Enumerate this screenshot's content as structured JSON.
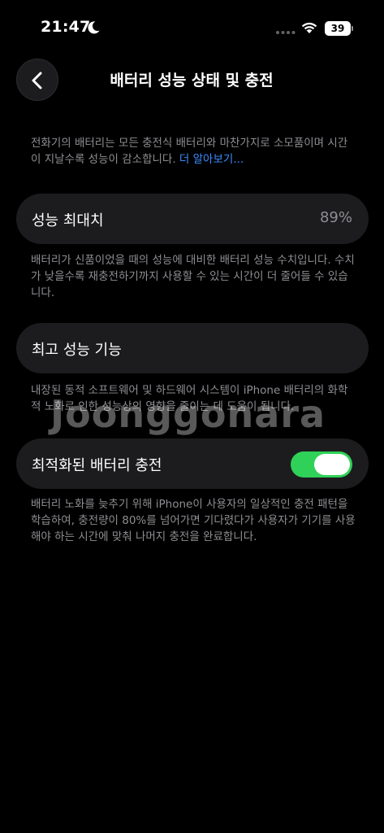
{
  "status_bar": {
    "time": "21:47",
    "battery_level": "39",
    "icons": [
      "moon-icon",
      "signal-dots-icon",
      "wifi-icon",
      "battery-icon"
    ]
  },
  "nav": {
    "back_icon": "chevron-left-icon",
    "title": "배터리 성능 상태 및 충전"
  },
  "intro": {
    "text": "전화기의 배터리는 모든 충전식 배터리와 마찬가지로 소모품이며 시간이 지날수록 성능이 감소합니다. ",
    "link": "더 알아보기..."
  },
  "max_capacity": {
    "label": "성능 최대치",
    "value": "89%",
    "description": "배터리가 신품이었을 때의 성능에 대비한 배터리 성능 수치입니다. 수치가 낮을수록 재충전하기까지 사용할 수 있는 시간이 더 줄어들 수 있습니다."
  },
  "peak_performance": {
    "label": "최고 성능 기능",
    "description": "내장된 동적 소프트웨어 및 하드웨어 시스템이 iPhone 배터리의 화학적 노화로 인한 성능상의 영향을 줄이는 데 도움이 됩니다."
  },
  "optimized_charging": {
    "label": "최적화된 배터리 충전",
    "enabled": true,
    "toggle_color": "#30d158",
    "description": "배터리 노화를 늦추기 위해 iPhone이 사용자의 일상적인 충전 패턴을 학습하여, 충전량이 80%를 넘어가면 기다렸다가 사용자가 기기를 사용해야 하는 시간에 맞춰 나머지 충전을 완료합니다."
  },
  "watermark": "Joonggonara"
}
